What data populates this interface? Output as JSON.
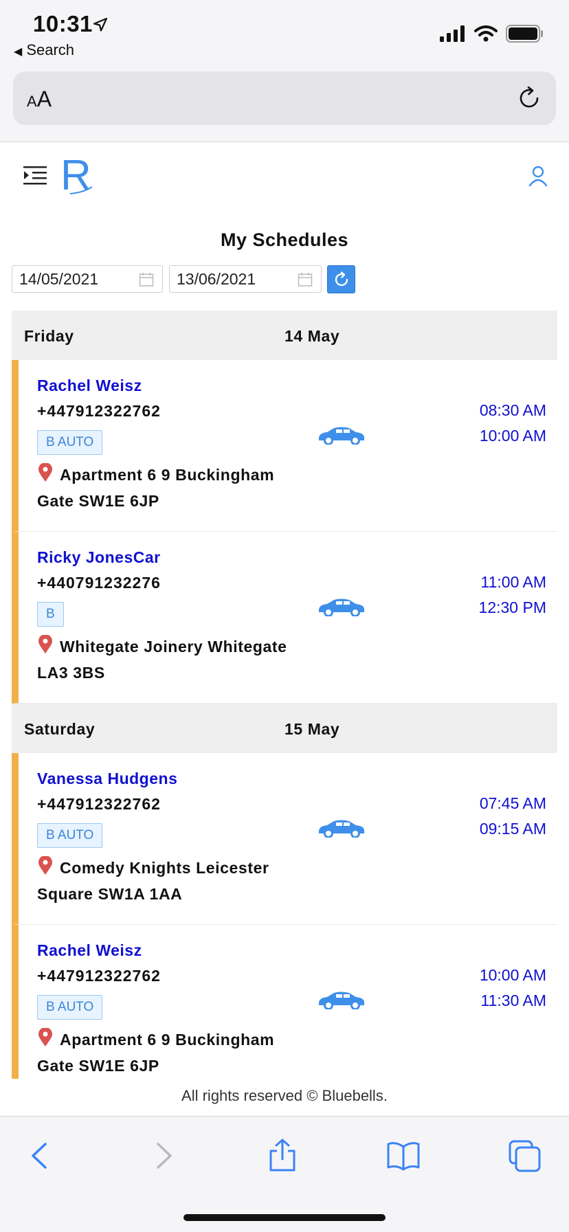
{
  "status_bar": {
    "time": "10:31",
    "back_label": "Search"
  },
  "address_bar": {
    "text_small": "A",
    "text_big": "A"
  },
  "header": {
    "logo_letter": "R"
  },
  "page": {
    "title": "My Schedules",
    "date_from": "14/05/2021",
    "date_to": "13/06/2021"
  },
  "days": [
    {
      "day": "Friday",
      "date": "14 May",
      "items": [
        {
          "name": "Rachel Weisz",
          "phone": "+447912322762",
          "badge": "B AUTO",
          "address": "Apartment 6 9 Buckingham Gate SW1E 6JP",
          "start": "08:30 AM",
          "end": "10:00 AM"
        },
        {
          "name": "Ricky JonesCar",
          "phone": "+440791232276",
          "badge": "B",
          "address": "Whitegate Joinery Whitegate LA3 3BS",
          "start": "11:00 AM",
          "end": "12:30 PM"
        }
      ]
    },
    {
      "day": "Saturday",
      "date": "15 May",
      "items": [
        {
          "name": "Vanessa Hudgens",
          "phone": "+447912322762",
          "badge": "B AUTO",
          "address": "Comedy Knights Leicester Square SW1A 1AA",
          "start": "07:45 AM",
          "end": "09:15 AM"
        },
        {
          "name": "Rachel Weisz",
          "phone": "+447912322762",
          "badge": "B AUTO",
          "address": "Apartment 6 9 Buckingham Gate SW1E 6JP",
          "start": "10:00 AM",
          "end": "11:30 AM"
        }
      ]
    }
  ],
  "footer": {
    "text": "All rights reserved © Bluebells."
  },
  "colors": {
    "accent": "#3e8fea",
    "link": "#1010d0",
    "card_border": "#f0b04a"
  }
}
